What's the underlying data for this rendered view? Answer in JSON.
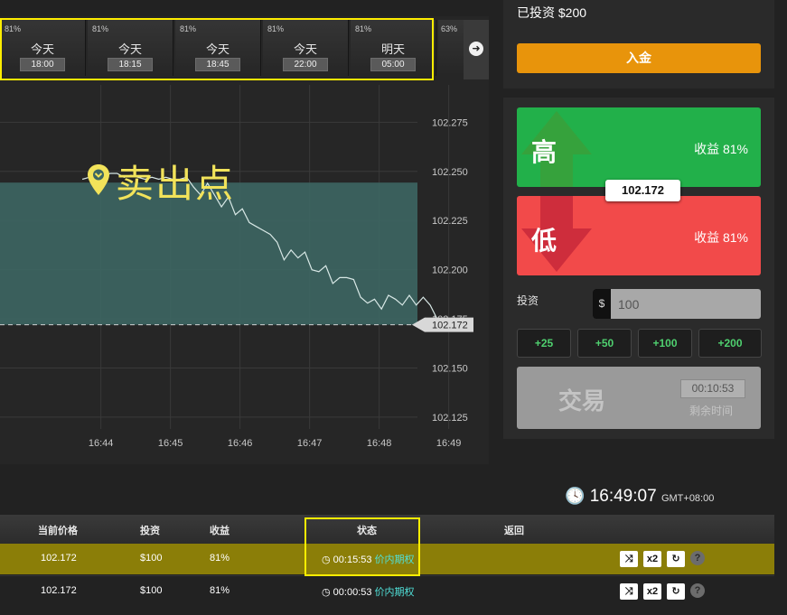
{
  "expiry": {
    "cards": [
      {
        "pct": "81%",
        "day": "今天",
        "time": "18:00"
      },
      {
        "pct": "81%",
        "day": "今天",
        "time": "18:15"
      },
      {
        "pct": "81%",
        "day": "今天",
        "time": "18:45"
      },
      {
        "pct": "81%",
        "day": "今天",
        "time": "22:00"
      },
      {
        "pct": "81%",
        "day": "明天",
        "time": "05:00"
      },
      {
        "pct": "63%",
        "day": "",
        "time": ""
      }
    ]
  },
  "chart_data": {
    "type": "area",
    "x_ticks": [
      "16:44",
      "16:45",
      "16:46",
      "16:47",
      "16:48",
      "16:49"
    ],
    "y_ticks": [
      102.275,
      102.25,
      102.225,
      102.2,
      102.175,
      102.15,
      102.125
    ],
    "ylim": [
      102.119,
      102.294
    ],
    "current_price": 102.172,
    "current_price_label": "102.172",
    "sell_level": 102.2443,
    "grid": true,
    "series": [
      {
        "x": [
          "16:43:44",
          "16:43:50",
          "16:43:56",
          "16:44:02",
          "16:44:08",
          "16:44:14",
          "16:44:20",
          "16:44:26",
          "16:44:32",
          "16:44:38",
          "16:44:44",
          "16:44:50",
          "16:44:56",
          "16:45:02",
          "16:45:08",
          "16:45:14",
          "16:45:20",
          "16:45:26",
          "16:45:32",
          "16:45:38",
          "16:45:44",
          "16:45:50",
          "16:45:56",
          "16:46:02",
          "16:46:08",
          "16:46:14",
          "16:46:20",
          "16:46:26",
          "16:46:32",
          "16:46:38",
          "16:46:44",
          "16:46:50",
          "16:46:56",
          "16:47:02",
          "16:47:08",
          "16:47:14",
          "16:47:20",
          "16:47:26",
          "16:47:32",
          "16:47:38",
          "16:47:44",
          "16:47:50",
          "16:47:56",
          "16:48:02",
          "16:48:08",
          "16:48:14",
          "16:48:20",
          "16:48:26",
          "16:48:32",
          "16:48:38",
          "16:48:44",
          "16:48:50"
        ],
        "values": [
          102.246,
          102.247,
          102.248,
          102.247,
          102.249,
          102.249,
          102.247,
          102.248,
          102.247,
          102.246,
          102.247,
          102.246,
          102.247,
          102.246,
          102.246,
          102.247,
          102.242,
          102.238,
          102.244,
          102.238,
          102.232,
          102.237,
          102.228,
          102.231,
          102.224,
          102.222,
          102.22,
          102.218,
          102.214,
          102.205,
          102.21,
          102.206,
          102.209,
          102.2,
          102.199,
          102.202,
          102.193,
          102.196,
          102.196,
          102.195,
          102.186,
          102.183,
          102.185,
          102.18,
          102.187,
          102.185,
          102.182,
          102.187,
          102.182,
          102.186,
          102.182,
          102.175
        ]
      }
    ]
  },
  "annotation": {
    "sell_point": "卖出点"
  },
  "account": {
    "invested": "已投资 $200",
    "deposit_label": "入金"
  },
  "trade": {
    "high_label": "高",
    "low_label": "低",
    "high_payout": "收益 81%",
    "low_payout": "收益 81%",
    "price_badge": "102.172",
    "invest_label": "投资",
    "currency": "$",
    "amount": "100",
    "quick_amounts": [
      "+25",
      "+50",
      "+100",
      "+200"
    ],
    "trade_label": "交易",
    "timer": "00:10:53",
    "remaining_label": "剩余时间"
  },
  "clock": {
    "time": "16:49:07",
    "timezone": "GMT+08:00"
  },
  "table": {
    "headers": [
      "当前价格",
      "投资",
      "收益",
      "状态",
      "返回"
    ],
    "rows": [
      {
        "price": "102.172",
        "investment": "$100",
        "payout": "81%",
        "time": "00:15:53",
        "state": "价内期权"
      },
      {
        "price": "102.172",
        "investment": "$100",
        "payout": "81%",
        "time": "00:00:53",
        "state": "价内期权"
      }
    ],
    "actions": [
      "x2"
    ]
  },
  "colors": {
    "high": "#22b04a",
    "low": "#f24a4a",
    "deposit": "#e8940b",
    "highlight_box": "#ffee00",
    "chart_fill": "#3d6663",
    "in_the_money": "#50e0d8"
  }
}
